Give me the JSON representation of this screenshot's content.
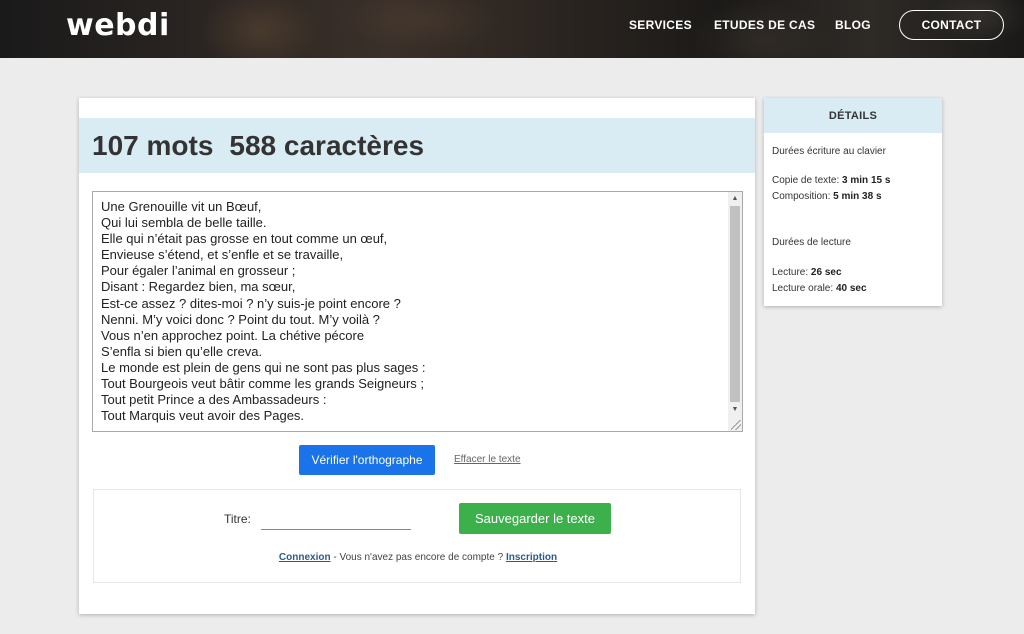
{
  "header": {
    "logo": "webdi",
    "nav": {
      "services": "SERVICES",
      "etudes": "ETUDES DE CAS",
      "blog": "BLOG",
      "contact": "CONTACT"
    }
  },
  "stats": {
    "words": "107 mots",
    "chars": "588 caractères"
  },
  "editor": {
    "lines": [
      "Une Grenouille vit un Bœuf,",
      "Qui lui sembla de belle taille.",
      "Elle qui n’était pas grosse en tout comme un œuf,",
      "Envieuse s’étend, et s’enfle et se travaille,",
      "Pour égaler l’animal en grosseur ;",
      "Disant : Regardez bien, ma sœur,",
      "Est-ce assez ? dites-moi ? n’y suis-je point encore ?",
      "Nenni. M’y voici donc ? Point du tout. M’y voilà ?",
      "Vous n’en approchez point. La chétive pécore",
      "S’enfla si bien qu’elle creva.",
      "Le monde est plein de gens qui ne sont pas plus sages :",
      "Tout Bourgeois veut bâtir comme les grands Seigneurs ;",
      "Tout petit Prince a des Ambassadeurs :",
      "Tout Marquis veut avoir des Pages."
    ]
  },
  "actions": {
    "verify": "Vérifier l'orthographe",
    "clear": "Effacer le texte"
  },
  "save": {
    "title_label": "Titre:",
    "title_value": "",
    "save_button": "Sauvegarder le texte",
    "login_link": "Connexion",
    "no_account_text": " - Vous n'avez pas encore de compte ? ",
    "register_link": "Inscription"
  },
  "details": {
    "heading": "DÉTAILS",
    "typing_heading": "Durées écriture au clavier",
    "copy_label": "Copie de texte: ",
    "copy_value": "3 min 15 s",
    "composition_label": "Composition: ",
    "composition_value": "5 min 38 s",
    "reading_heading": "Durées de lecture",
    "reading_label": "Lecture: ",
    "reading_value": "26 sec",
    "oral_label": "Lecture orale: ",
    "oral_value": "40 sec"
  }
}
